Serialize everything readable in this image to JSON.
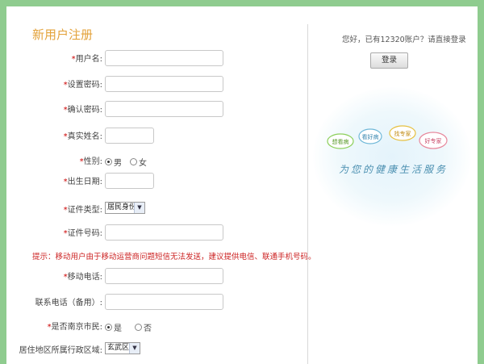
{
  "form": {
    "title": "新用户注册",
    "required_mark": "*",
    "fields": {
      "username": "用户名:",
      "password": "设置密码:",
      "confirm_password": "确认密码:",
      "real_name": "真实姓名:",
      "gender": "性别:",
      "birth_date": "出生日期:",
      "id_type": "证件类型:",
      "id_number": "证件号码:",
      "mobile": "移动电话:",
      "phone_backup": "联系电话（备用）:",
      "nanjing_resident": "是否南京市民:",
      "district": "居住地区所属行政区域:"
    },
    "gender_options": {
      "male": "男",
      "female": "女"
    },
    "resident_options": {
      "yes": "是",
      "no": "否"
    },
    "id_type_value": "居民身份证",
    "district_value": "玄武区",
    "hint": "提示：移动用户由于移动运营商问题短信无法发送，建议提供电信、联通手机号码。"
  },
  "sidebar": {
    "greeting": "您好，已有12320账户？请直接登录",
    "login_label": "登录",
    "clouds": [
      "想看病",
      "看好病",
      "找专家",
      "好专家"
    ],
    "slogan": "为您的健康生活服务"
  },
  "colors": {
    "background": "#8fcc8f",
    "title": "#e3a23a",
    "required": "#cc0000",
    "hint": "#cc2222"
  }
}
